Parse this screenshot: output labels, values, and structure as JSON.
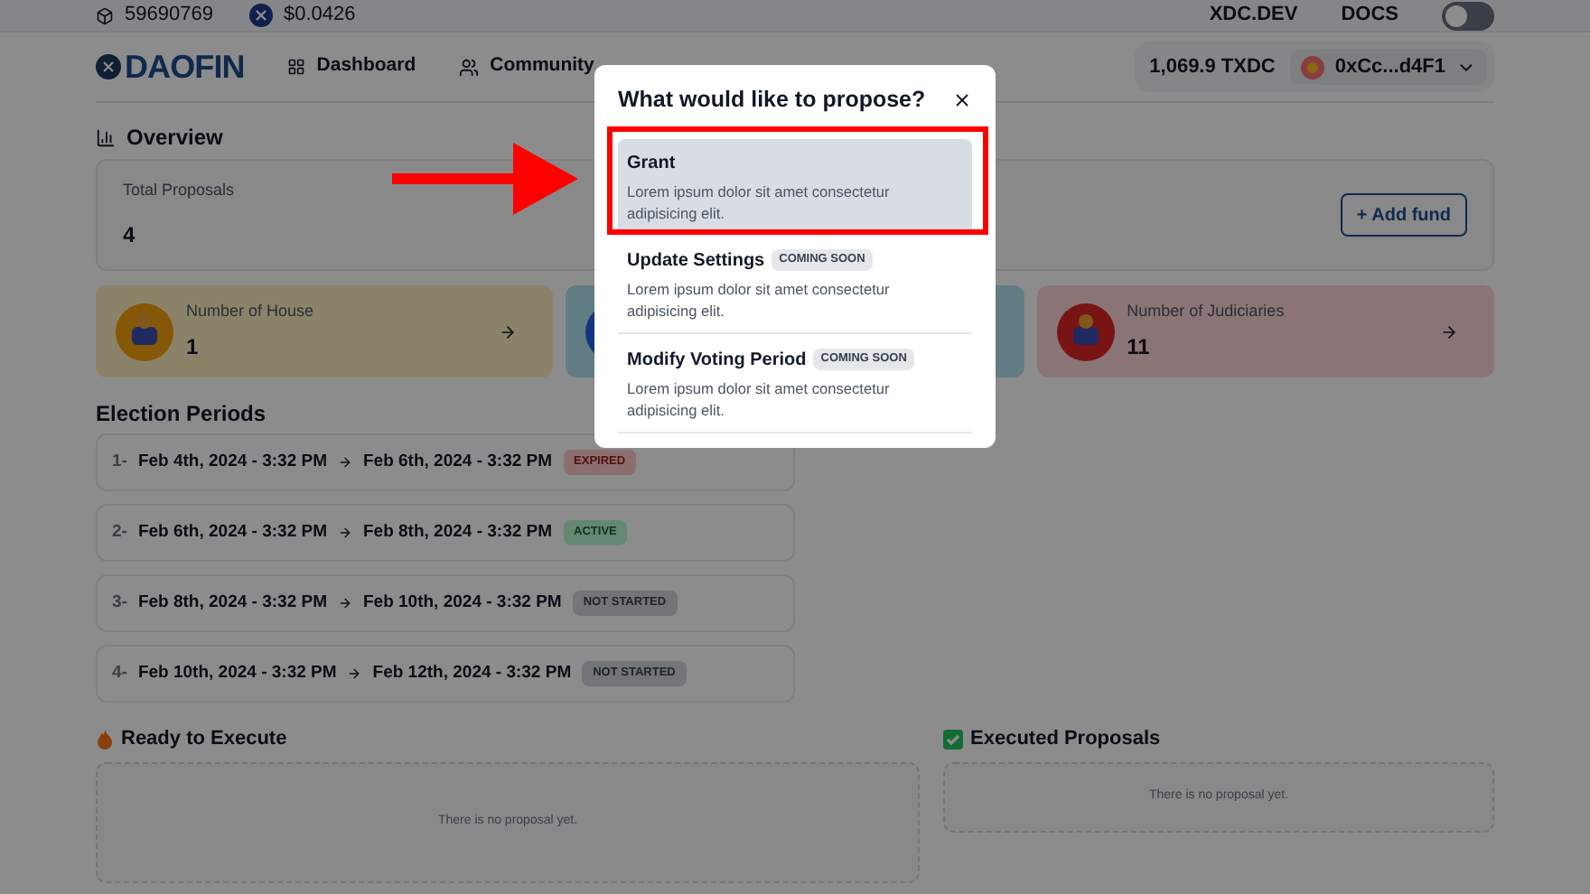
{
  "top_bar": {
    "block": "59690769",
    "price": "$0.0426",
    "links": [
      "XDC.DEV",
      "DOCS"
    ],
    "theme_toggle": {
      "on": false
    }
  },
  "header": {
    "logo": "DAOFIN",
    "nav": [
      "Dashboard",
      "Community"
    ],
    "balance": "1,069.9 TXDC",
    "account": "0xCc...d4F1"
  },
  "overview": {
    "title": "Overview",
    "total_label": "Total Proposals",
    "total_value": "4",
    "add_fund": "+ Add fund"
  },
  "stat_cards": [
    {
      "label": "Number of House",
      "value": "1",
      "kind": "house"
    },
    {
      "kind": "senate"
    },
    {
      "label": "Number of Judiciaries",
      "value": "11",
      "kind": "judiciary"
    }
  ],
  "election_periods": {
    "title": "Election Periods",
    "rows": [
      {
        "index": "1-",
        "start": "Feb 4th, 2024 - 3:32 PM",
        "end": "Feb 6th, 2024 - 3:32 PM",
        "status": "EXPIRED",
        "kind": "expired"
      },
      {
        "index": "2-",
        "start": "Feb 6th, 2024 - 3:32 PM",
        "end": "Feb 8th, 2024 - 3:32 PM",
        "status": "ACTIVE",
        "kind": "active"
      },
      {
        "index": "3-",
        "start": "Feb 8th, 2024 - 3:32 PM",
        "end": "Feb 10th, 2024 - 3:32 PM",
        "status": "NOT STARTED",
        "kind": "pending"
      },
      {
        "index": "4-",
        "start": "Feb 10th, 2024 - 3:32 PM",
        "end": "Feb 12th, 2024 - 3:32 PM",
        "status": "NOT STARTED",
        "kind": "pending"
      }
    ]
  },
  "ready_to_execute": {
    "title": "Ready to Execute",
    "empty": "There is no proposal yet."
  },
  "executed_proposals": {
    "title": "Executed Proposals",
    "empty": "There is no proposal yet."
  },
  "modal": {
    "title": "What would like to propose?",
    "options": [
      {
        "title": "Grant",
        "description": "Lorem ipsum dolor sit amet consectetur adipisicing elit.",
        "selected": true
      },
      {
        "title": "Update Settings",
        "badge": "COMING SOON",
        "description": "Lorem ipsum dolor sit amet consectetur adipisicing elit.",
        "selected": false
      },
      {
        "title": "Modify Voting Period",
        "badge": "COMING SOON",
        "description": "Lorem ipsum dolor sit amet consectetur adipisicing elit.",
        "selected": false
      }
    ]
  }
}
